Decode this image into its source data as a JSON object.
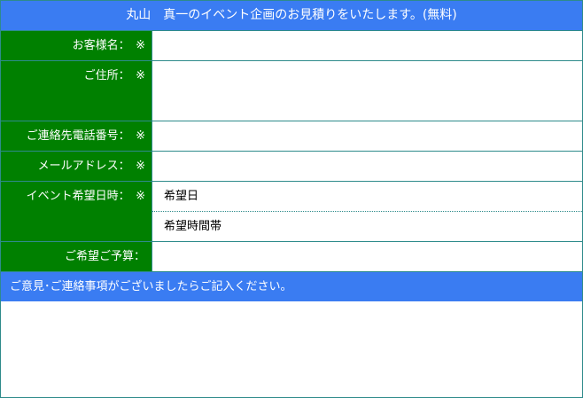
{
  "form": {
    "title": "丸山　真一のイベント企画のお見積りをいたします。(無料)",
    "fields": {
      "name": "お客様名：　※",
      "address": "ご住所：　※",
      "phone": "ご連絡先電話番号：　※",
      "email": "メールアドレス：　※",
      "event_date": "イベント希望日時：　※",
      "budget": "ご希望ご予算："
    },
    "date_sub": {
      "date": "希望日",
      "time": "希望時間帯"
    },
    "comments_label": "ご意見･ご連絡事項がございましたらご記入ください。"
  },
  "colors": {
    "header_blue": "#3a7cf2",
    "label_green": "#008000",
    "border_teal": "#2e8b8b"
  }
}
